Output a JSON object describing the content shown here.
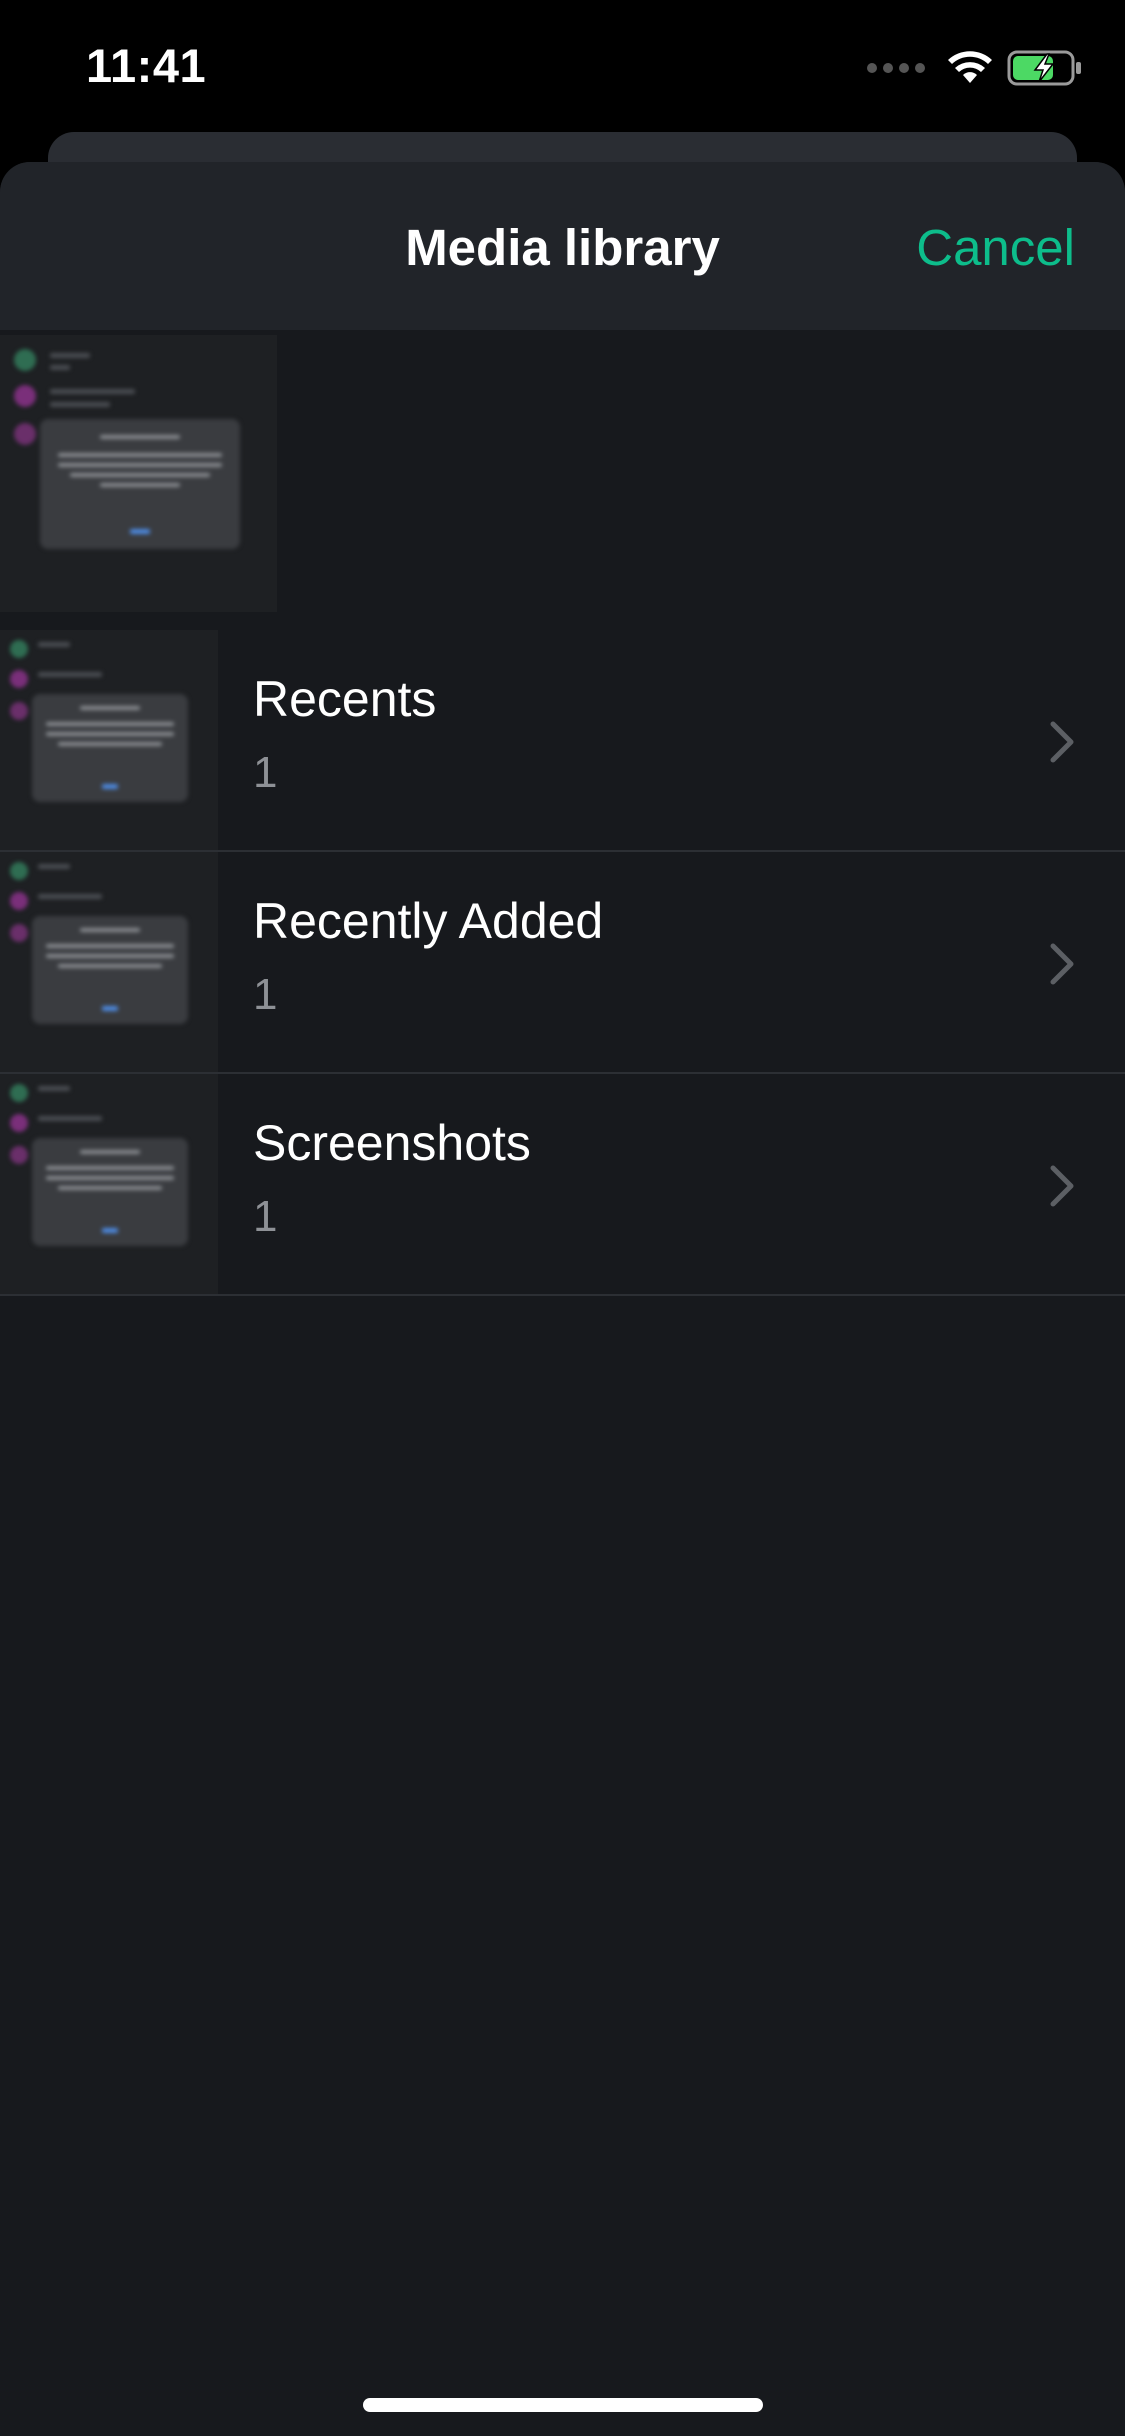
{
  "status_bar": {
    "time": "11:41"
  },
  "nav": {
    "title": "Media library",
    "cancel_label": "Cancel"
  },
  "albums": [
    {
      "title": "Recents",
      "count": "1"
    },
    {
      "title": "Recently Added",
      "count": "1"
    },
    {
      "title": "Screenshots",
      "count": "1"
    }
  ],
  "colors": {
    "accent": "#0dbd8b",
    "background": "#17191d",
    "nav_background": "#212429",
    "battery_green": "#4cd964"
  },
  "icons": {
    "wifi": "wifi-icon",
    "battery": "battery-charging-icon",
    "chevron": "chevron-right-icon"
  }
}
